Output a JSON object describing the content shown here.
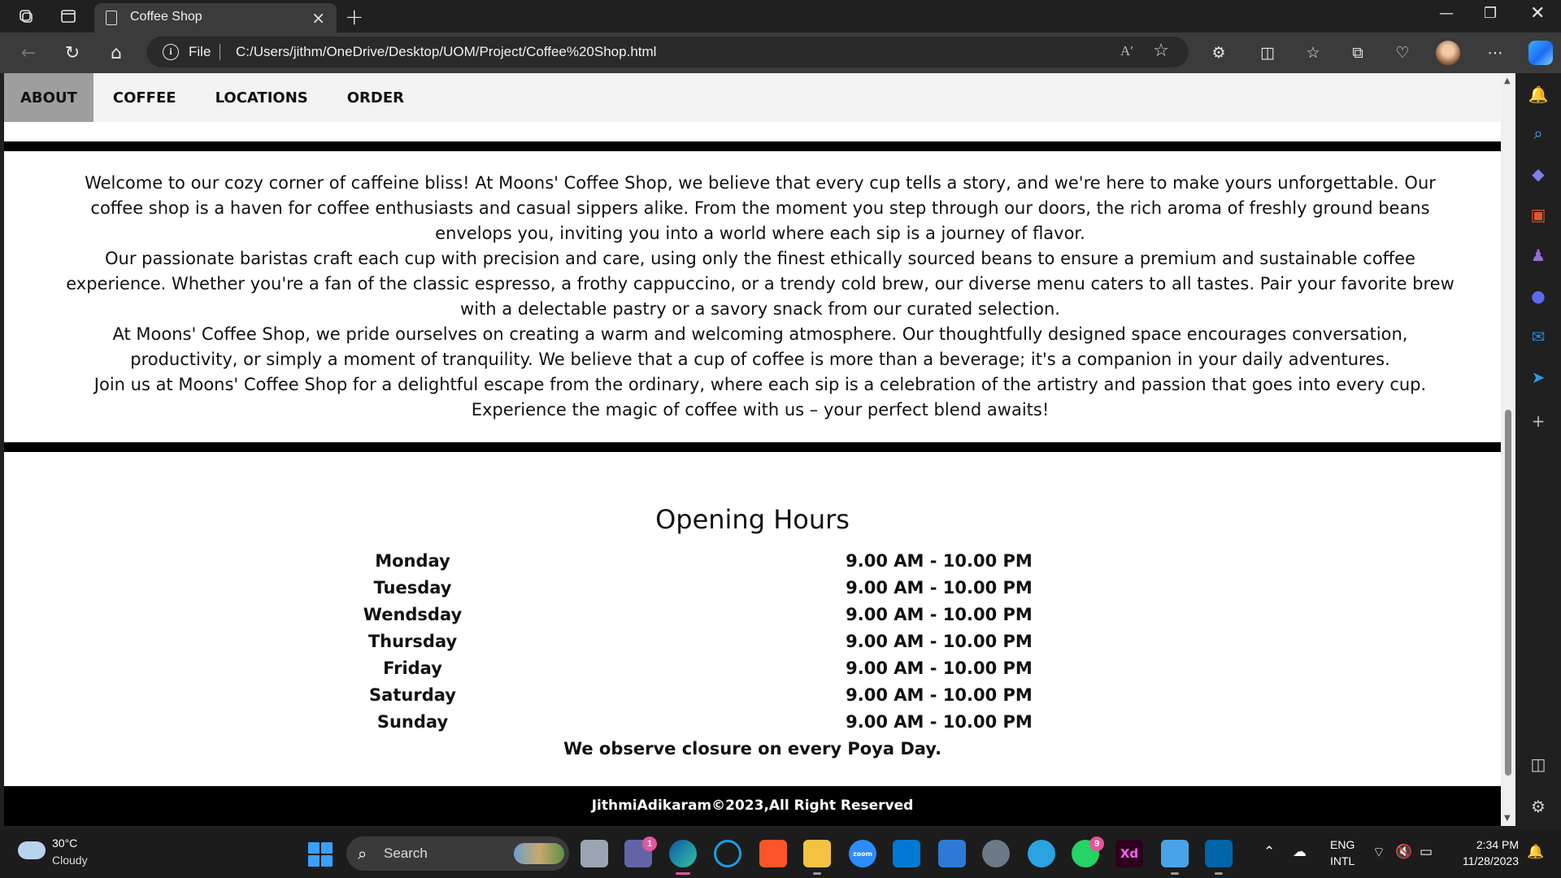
{
  "browser": {
    "tab_title": "Coffee Shop",
    "file_label": "File",
    "url": "C:/Users/jithm/OneDrive/Desktop/UOM/Project/Coffee%20Shop.html",
    "read_aloud_label": "Aʹ"
  },
  "site": {
    "nav": [
      {
        "label": "ABOUT",
        "active": true
      },
      {
        "label": "COFFEE",
        "active": false
      },
      {
        "label": "LOCATIONS",
        "active": false
      },
      {
        "label": "ORDER",
        "active": false
      }
    ],
    "about_paragraphs": [
      "Welcome to our cozy corner of caffeine bliss! At Moons' Coffee Shop, we believe that every cup tells a story, and we're here to make yours unforgettable. Our coffee shop is a haven for coffee enthusiasts and casual sippers alike. From the moment you step through our doors, the rich aroma of freshly ground beans envelops you, inviting you into a world where each sip is a journey of flavor.",
      "Our passionate baristas craft each cup with precision and care, using only the finest ethically sourced beans to ensure a premium and sustainable coffee experience. Whether you're a fan of the classic espresso, a frothy cappuccino, or a trendy cold brew, our diverse menu caters to all tastes. Pair your favorite brew with a delectable pastry or a savory snack from our curated selection.",
      "At Moons' Coffee Shop, we pride ourselves on creating a warm and welcoming atmosphere. Our thoughtfully designed space encourages conversation, productivity, or simply a moment of tranquility. We believe that a cup of coffee is more than a beverage; it's a companion in your daily adventures.",
      "Join us at Moons' Coffee Shop for a delightful escape from the ordinary, where each sip is a celebration of the artistry and passion that goes into every cup. Experience the magic of coffee with us – your perfect blend awaits!"
    ],
    "hours_title": "Opening Hours",
    "hours": [
      {
        "day": "Monday",
        "time": "9.00 AM - 10.00 PM"
      },
      {
        "day": "Tuesday",
        "time": "9.00 AM - 10.00 PM"
      },
      {
        "day": "Wendsday",
        "time": "9.00 AM - 10.00 PM"
      },
      {
        "day": "Thursday",
        "time": "9.00 AM - 10.00 PM"
      },
      {
        "day": "Friday",
        "time": "9.00 AM - 10.00 PM"
      },
      {
        "day": "Saturday",
        "time": "9.00 AM - 10.00 PM"
      },
      {
        "day": "Sunday",
        "time": "9.00 AM - 10.00 PM"
      }
    ],
    "closure_note": "We observe closure on every Poya Day.",
    "footer": "JithmiAdikaram©2023,All Right Reserved"
  },
  "taskbar": {
    "weather_temp": "30°C",
    "weather_desc": "Cloudy",
    "search_label": "Search",
    "teams_badge": "1",
    "whatsapp_badge": "9",
    "xd_label": "Xd",
    "zoom_label": "zoom",
    "lang_line1": "ENG",
    "lang_line2": "INTL",
    "time": "2:34 PM",
    "date": "11/28/2023"
  },
  "colors": {
    "nav_active_bg": "#9e9e9e",
    "rule": "#000000",
    "footer_bg": "#000000",
    "browser_chrome": "#202020"
  }
}
